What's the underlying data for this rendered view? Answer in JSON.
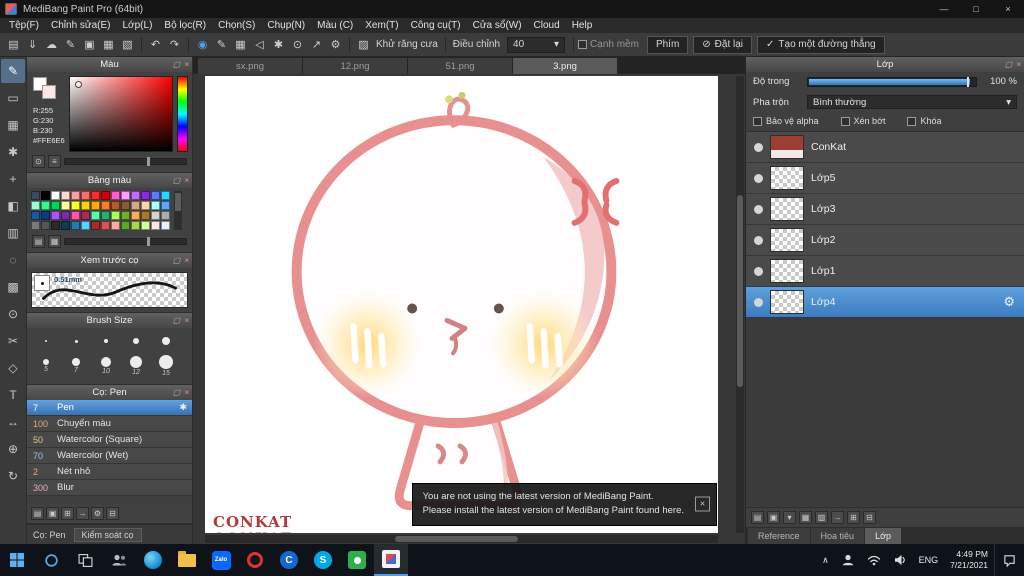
{
  "titlebar": {
    "title": "MediBang Paint Pro (64bit)"
  },
  "window_controls": {
    "minimize": "—",
    "maximize": "□",
    "close": "×"
  },
  "menubar": {
    "items": [
      "Tệp(F)",
      "Chỉnh sửa(E)",
      "Lớp(L)",
      "Bộ lọc(R)",
      "Chọn(S)",
      "Chụp(N)",
      "Màu (C)",
      "Xem(T)",
      "Công cụ(T)",
      "Cửa sổ(W)",
      "Cloud",
      "Help"
    ]
  },
  "toolbar": {
    "left_icons": [
      "▤",
      "⇓",
      "☁",
      "✎",
      "▣",
      "▦",
      "▧"
    ],
    "undo_icon": "↶",
    "redo_icon": "↷",
    "mid_icons": [
      "◉",
      "✎",
      "▦",
      "◁",
      "✱",
      "⊙",
      "↗",
      "⚙"
    ],
    "aa_icon": "▨",
    "antialias_label": "Khử răng cưa",
    "adjust_label": "Điều chỉnh",
    "adjust_value": "40",
    "caret_icon": "▾",
    "soft_edge_label": "Cạnh mềm",
    "key_button": "Phím",
    "reset_icon": "⊘",
    "reset_button": "Đặt lại",
    "check_icon": "✓",
    "line_button": "Tạo một đường thẳng"
  },
  "toolstrip": [
    "✎",
    "▭",
    "▦",
    "✱",
    "+",
    "◧",
    "▥",
    "◌",
    "▩",
    "⊙",
    "✂",
    "◇",
    "T",
    "↔",
    "⊕",
    "↻"
  ],
  "panels": {
    "color": {
      "title": "Màu",
      "r": "R:255",
      "g": "G:230",
      "b": "B:230",
      "hex": "#FFE6E6",
      "footer_icons": [
        "⊙",
        "≡"
      ]
    },
    "palette": {
      "title": "Bảng màu",
      "footer_icons": [
        "▤",
        "▦"
      ],
      "swatches": [
        "#3b4a63",
        "#000000",
        "#ffffff",
        "#ffd9d9",
        "#ff9e9e",
        "#ff6b6b",
        "#ff2a2a",
        "#d40000",
        "#ff5ad4",
        "#ff9eff",
        "#c36bff",
        "#8a2ae0",
        "#5a7aff",
        "#2ad4ff",
        "#9effd4",
        "#2aff8a",
        "#00d455",
        "#ffff9e",
        "#ffff2a",
        "#ffd400",
        "#ffaa00",
        "#ff7a2a",
        "#b45a2a",
        "#8a5a3b",
        "#d4aa8a",
        "#ffd4aa",
        "#aaffff",
        "#55aaff",
        "#1a55aa",
        "#103b7a",
        "#aa55ff",
        "#7a2aaa",
        "#ff55aa",
        "#aa2a55",
        "#55ffaa",
        "#2aaa7a",
        "#aaff55",
        "#7aaa2a",
        "#ffaa55",
        "#aa7a2a",
        "#d4d4d4",
        "#aaaaaa",
        "#7a7a7a",
        "#555555",
        "#2a2a2a",
        "#103b55",
        "#2a7aaa",
        "#55d4ff",
        "#aa2a2a",
        "#d45555",
        "#ffaaaa",
        "#55aa2a",
        "#aad455",
        "#d4ff9e",
        "#ffe6e6",
        "#e6f0ff"
      ]
    },
    "preview": {
      "title": "Xem trước cọ",
      "size_label": "0.51mm"
    },
    "brush_size": {
      "title": "Brush Size",
      "labels": [
        "5",
        "7",
        "10",
        "12",
        "15"
      ]
    },
    "brushes": {
      "title": "Cọ: Pen",
      "settings_icon": "✱",
      "items": [
        {
          "size": "7",
          "name": "Pen",
          "color": "#ffffff"
        },
        {
          "size": "100",
          "name": "Chuyển màu",
          "color": "#e8a87c"
        },
        {
          "size": "50",
          "name": "Watercolor (Square)",
          "color": "#ddc98a"
        },
        {
          "size": "70",
          "name": "Watercolor (Wet)",
          "color": "#9ec3e6"
        },
        {
          "size": "2",
          "name": "Nét nhỏ",
          "color": "#e8a87c"
        },
        {
          "size": "300",
          "name": "Blur",
          "color": "#e6a9c6"
        }
      ],
      "footer_icons": [
        "▤",
        "▣",
        "⊞",
        "→",
        "⚙",
        "⊟"
      ]
    }
  },
  "statusbar": {
    "brush_label": "Cọ: Pen",
    "control_button": "Kiểm soát cọ"
  },
  "canvas": {
    "tabs": [
      "sx.png",
      "12.png",
      "51.png",
      "3.png"
    ],
    "watermark": "CONKAT"
  },
  "toast": {
    "line1": "You are not using the latest version of MediBang Paint.",
    "line2": "Please install the latest version of MediBang Paint found here.",
    "close": "×"
  },
  "layer_panel": {
    "title": "Lớp",
    "opacity_label": "Độ trong",
    "opacity_value": "100 %",
    "blend_label": "Pha trộn",
    "blend_value": "Bình thường",
    "checkboxes": {
      "alpha": "Bảo vệ alpha",
      "clip": "Xén bớt",
      "lock": "Khóa"
    },
    "layers": [
      "ConKat",
      "Lớp5",
      "Lớp3",
      "Lớp2",
      "Lớp1",
      "Lớp4"
    ],
    "gear_icon": "⚙",
    "footer_icons": [
      "▤",
      "▣",
      "▾",
      "▦",
      "▧",
      "→",
      "⊞",
      "⊟"
    ],
    "tabs": [
      "Reference",
      "Hoa tiêu",
      "Lớp"
    ]
  },
  "taskbar": {
    "lang": "ENG",
    "time": "4:49 PM",
    "date": "7/21/2021",
    "zalo_label": "Zalo",
    "coccoc_letter": "C",
    "skype_letter": "S"
  },
  "icons": {
    "popout": "▢",
    "close": "×",
    "chevron_up": "∧"
  }
}
